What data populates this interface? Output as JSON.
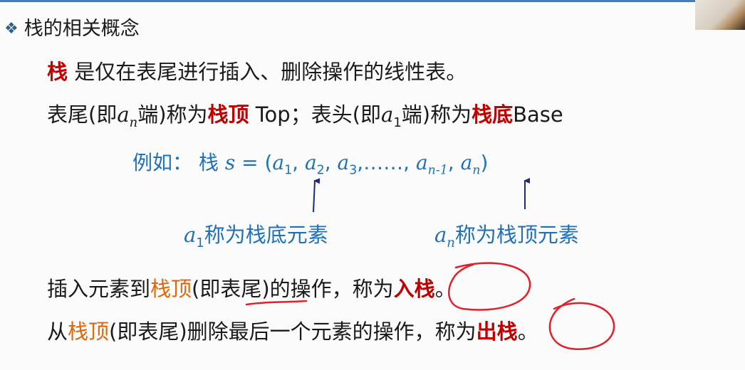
{
  "title": {
    "bullet": "❖",
    "text": "栈的相关概念"
  },
  "line1": {
    "term": "栈",
    "rest": " 是仅在表尾进行插入、删除操作的线性表。"
  },
  "line2": {
    "p1": "表尾(即",
    "an_a": "a",
    "an_sub": "n",
    "p2": "端)称为",
    "top_term": "栈顶",
    "p3": " Top；表头(即",
    "a1_a": "a",
    "a1_sub": "1",
    "p4": "端)称为",
    "base_term": "栈底",
    "p5": "Base"
  },
  "example": {
    "prefix": "例如：  栈  ",
    "s": "s",
    "eq": " = (",
    "e1": "a",
    "e1s": "1",
    "c1": ", ",
    "e2": "a",
    "e2s": "2",
    "c2": ", ",
    "e3": "a",
    "e3s": "3",
    "dots": ",……, ",
    "e4": "a",
    "e4s": "n-1",
    "c3": ", ",
    "e5": "a",
    "e5s": "n",
    "close": ")"
  },
  "label_bottom": {
    "a": "a",
    "sub": "1",
    "text": "称为栈底元素"
  },
  "label_top": {
    "a": "a",
    "sub": "n",
    "text": "称为栈顶元素"
  },
  "line3": {
    "p1": "插入元素到",
    "term": "栈顶",
    "p2": "(即表尾)的操作，称为",
    "op": "入栈",
    "end": "。"
  },
  "line4": {
    "p1": "从",
    "term": "栈顶",
    "p2": "(即表尾)删除最后一个元素的操作，称为",
    "op": "出栈",
    "end": "。"
  },
  "colors": {
    "accent_blue": "#1f72b8",
    "term_red": "#c00000",
    "term_orange": "#e0660a",
    "ink_red": "#e0202a",
    "arrow_navy": "#1b2a7a"
  }
}
